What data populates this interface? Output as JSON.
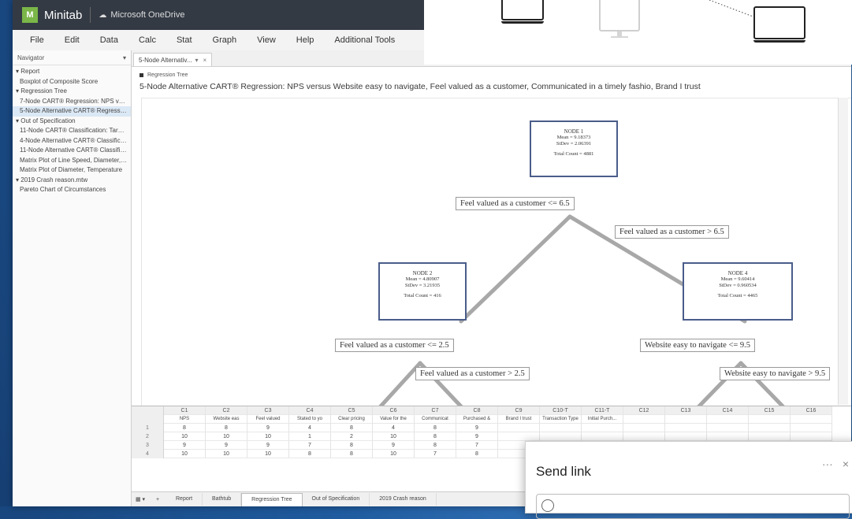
{
  "app": {
    "brand": "Minitab",
    "logo_letters": "M",
    "user": "Microsoft OneDrive"
  },
  "menu": [
    "File",
    "Edit",
    "Data",
    "Calc",
    "Stat",
    "Graph",
    "View",
    "Help",
    "Additional Tools"
  ],
  "navigator": {
    "title": "Navigator",
    "items": [
      {
        "label": "Report",
        "type": "grp"
      },
      {
        "label": "Boxplot of Composite Score",
        "type": "itm"
      },
      {
        "label": "Regression Tree",
        "type": "grp"
      },
      {
        "label": "7-Node CART® Regression: NPS versus ...",
        "type": "itm"
      },
      {
        "label": "5-Node Alternative CART® Regression ...",
        "type": "itm",
        "selected": true
      },
      {
        "label": "Out of Specification",
        "type": "grp"
      },
      {
        "label": "11-Node CART® Classification: Target ve...",
        "type": "itm"
      },
      {
        "label": "4-Node Alternative CART® Classification...",
        "type": "itm"
      },
      {
        "label": "11-Node Alternative CART® Classificatio...",
        "type": "itm"
      },
      {
        "label": "Matrix Plot of Line Speed, Diameter, Ten...",
        "type": "itm"
      },
      {
        "label": "Matrix Plot of Diameter, Temperature",
        "type": "itm"
      },
      {
        "label": "2019 Crash reason.mtw",
        "type": "grp"
      },
      {
        "label": "Pareto Chart of Circumstances",
        "type": "itm"
      }
    ]
  },
  "doc_tab": {
    "label": "5-Node Alternativ...",
    "pin": "▾",
    "close": "×"
  },
  "output": {
    "header": "Regression Tree",
    "title": "5-Node Alternative CART® Regression: NPS versus Website easy to navigate, Feel valued as a customer, Communicated in a timely fashio, Brand I trust"
  },
  "tree": {
    "nodes": [
      {
        "id": "NODE 1",
        "mean": "Mean = 9.18373",
        "stdev": "StDev = 2.06391",
        "count": "Total Count = 4881"
      },
      {
        "id": "NODE 2",
        "mean": "Mean = 4.80907",
        "stdev": "StDev = 3.21935",
        "count": "Total Count = 416"
      },
      {
        "id": "NODE 4",
        "mean": "Mean = 9.60414",
        "stdev": "StDev = 0.960534",
        "count": "Total Count = 4465"
      }
    ],
    "splits": [
      "Feel valued as a customer <= 6.5",
      "Feel valued as a customer > 6.5",
      "Feel valued as a customer <= 2.5",
      "Feel valued as a customer > 2.5",
      "Website easy to navigate <= 9.5",
      "Website easy to navigate > 9.5"
    ]
  },
  "worksheet": {
    "columns": [
      "C1",
      "C2",
      "C3",
      "C4",
      "C5",
      "C6",
      "C7",
      "C8",
      "C9",
      "C10-T",
      "C11-T",
      "C12",
      "C13",
      "C14",
      "C15",
      "C16"
    ],
    "names": [
      "NPS",
      "Website eas",
      "Feel valued",
      "Stated to yo",
      "Clear pricing",
      "Value for the",
      "Communicat",
      "Purchased &",
      "Brand I trust",
      "Transaction Type",
      "Initial Purch...",
      "",
      "",
      "",
      "",
      ""
    ],
    "rows": [
      {
        "n": "1",
        "cells": [
          "8",
          "8",
          "9",
          "4",
          "8",
          "4",
          "8",
          "9",
          "",
          "",
          "",
          "",
          "",
          "",
          "",
          ""
        ]
      },
      {
        "n": "2",
        "cells": [
          "10",
          "10",
          "10",
          "1",
          "2",
          "10",
          "8",
          "9",
          "",
          "",
          "",
          "",
          "",
          "",
          "",
          ""
        ]
      },
      {
        "n": "3",
        "cells": [
          "9",
          "9",
          "9",
          "7",
          "8",
          "9",
          "8",
          "7",
          "",
          "",
          "",
          "",
          "",
          "",
          "",
          ""
        ]
      },
      {
        "n": "4",
        "cells": [
          "10",
          "10",
          "10",
          "8",
          "8",
          "10",
          "7",
          "8",
          "",
          "",
          "",
          "",
          "",
          "",
          "",
          ""
        ]
      }
    ]
  },
  "sheet_tabs": {
    "menu": "▦ ▾",
    "add": "+",
    "tabs": [
      "Report",
      "Bathtub",
      "Regression Tree",
      "Out of Specification",
      "2019 Crash reason"
    ],
    "active": 2
  },
  "send_link": {
    "title": "Send link",
    "more": "···",
    "close": "×"
  }
}
